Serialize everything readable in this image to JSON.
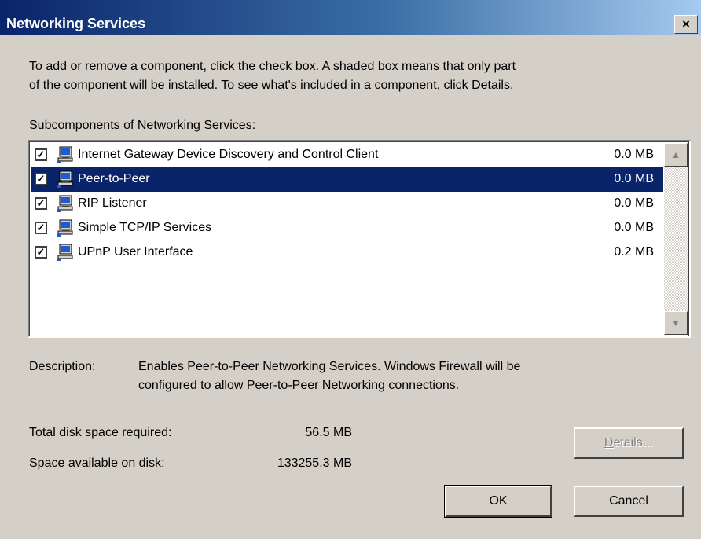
{
  "window": {
    "title": "Networking Services",
    "close_glyph": "×"
  },
  "intro": {
    "line1": "To add or remove a component, click the check box. A shaded box means that only part",
    "line2": "of the component will be installed. To see what's included in a component, click Details."
  },
  "list": {
    "label_pre": "Sub",
    "label_accel": "c",
    "label_post": "omponents of Networking Services:",
    "items": [
      {
        "label": "Internet Gateway Device Discovery and Control Client",
        "size": "0.0 MB",
        "checked": true,
        "selected": false,
        "icon": "network-computer-icon"
      },
      {
        "label": "Peer-to-Peer",
        "size": "0.0 MB",
        "checked": true,
        "selected": true,
        "icon": "network-computer-icon"
      },
      {
        "label": "RIP Listener",
        "size": "0.0 MB",
        "checked": true,
        "selected": false,
        "icon": "network-computer-icon"
      },
      {
        "label": "Simple TCP/IP Services",
        "size": "0.0 MB",
        "checked": true,
        "selected": false,
        "icon": "network-computer-icon"
      },
      {
        "label": "UPnP User Interface",
        "size": "0.2 MB",
        "checked": true,
        "selected": false,
        "icon": "network-computer-icon"
      }
    ],
    "check_glyph": "✓",
    "scroll_up_glyph": "▲",
    "scroll_down_glyph": "▼"
  },
  "description": {
    "label": "Description:",
    "line1": "Enables Peer-to-Peer Networking Services. Windows Firewall will be",
    "line2": "configured to allow Peer-to-Peer Networking connections."
  },
  "disk": {
    "required_label": "Total disk space required:",
    "required_value": "56.5 MB",
    "available_label": "Space available on disk:",
    "available_value": "133255.3 MB"
  },
  "buttons": {
    "details_accel": "D",
    "details_rest": "etails...",
    "ok": "OK",
    "cancel": "Cancel"
  },
  "colors": {
    "selection": "#0a246a",
    "face": "#d4d0c8",
    "title_gradient_start": "#0a246a",
    "title_gradient_end": "#a6caf0"
  }
}
